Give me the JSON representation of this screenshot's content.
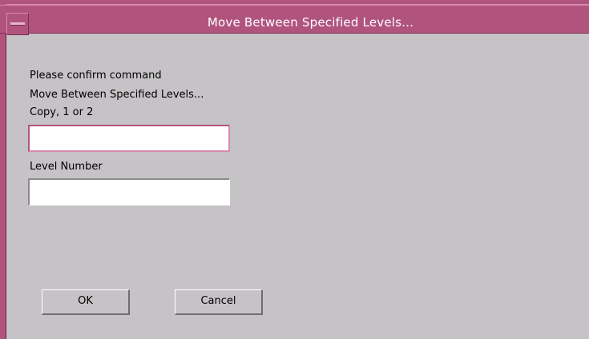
{
  "window": {
    "title": "Move Between Specified Levels...",
    "accent_color": "#b0547e"
  },
  "dialog": {
    "prompt": "Please confirm command",
    "command": "Move Between Specified Levels...",
    "copy_label": "Copy, 1 or 2",
    "copy_value": "",
    "level_label": "Level Number",
    "level_value": ""
  },
  "buttons": {
    "ok": "OK",
    "cancel": "Cancel"
  }
}
